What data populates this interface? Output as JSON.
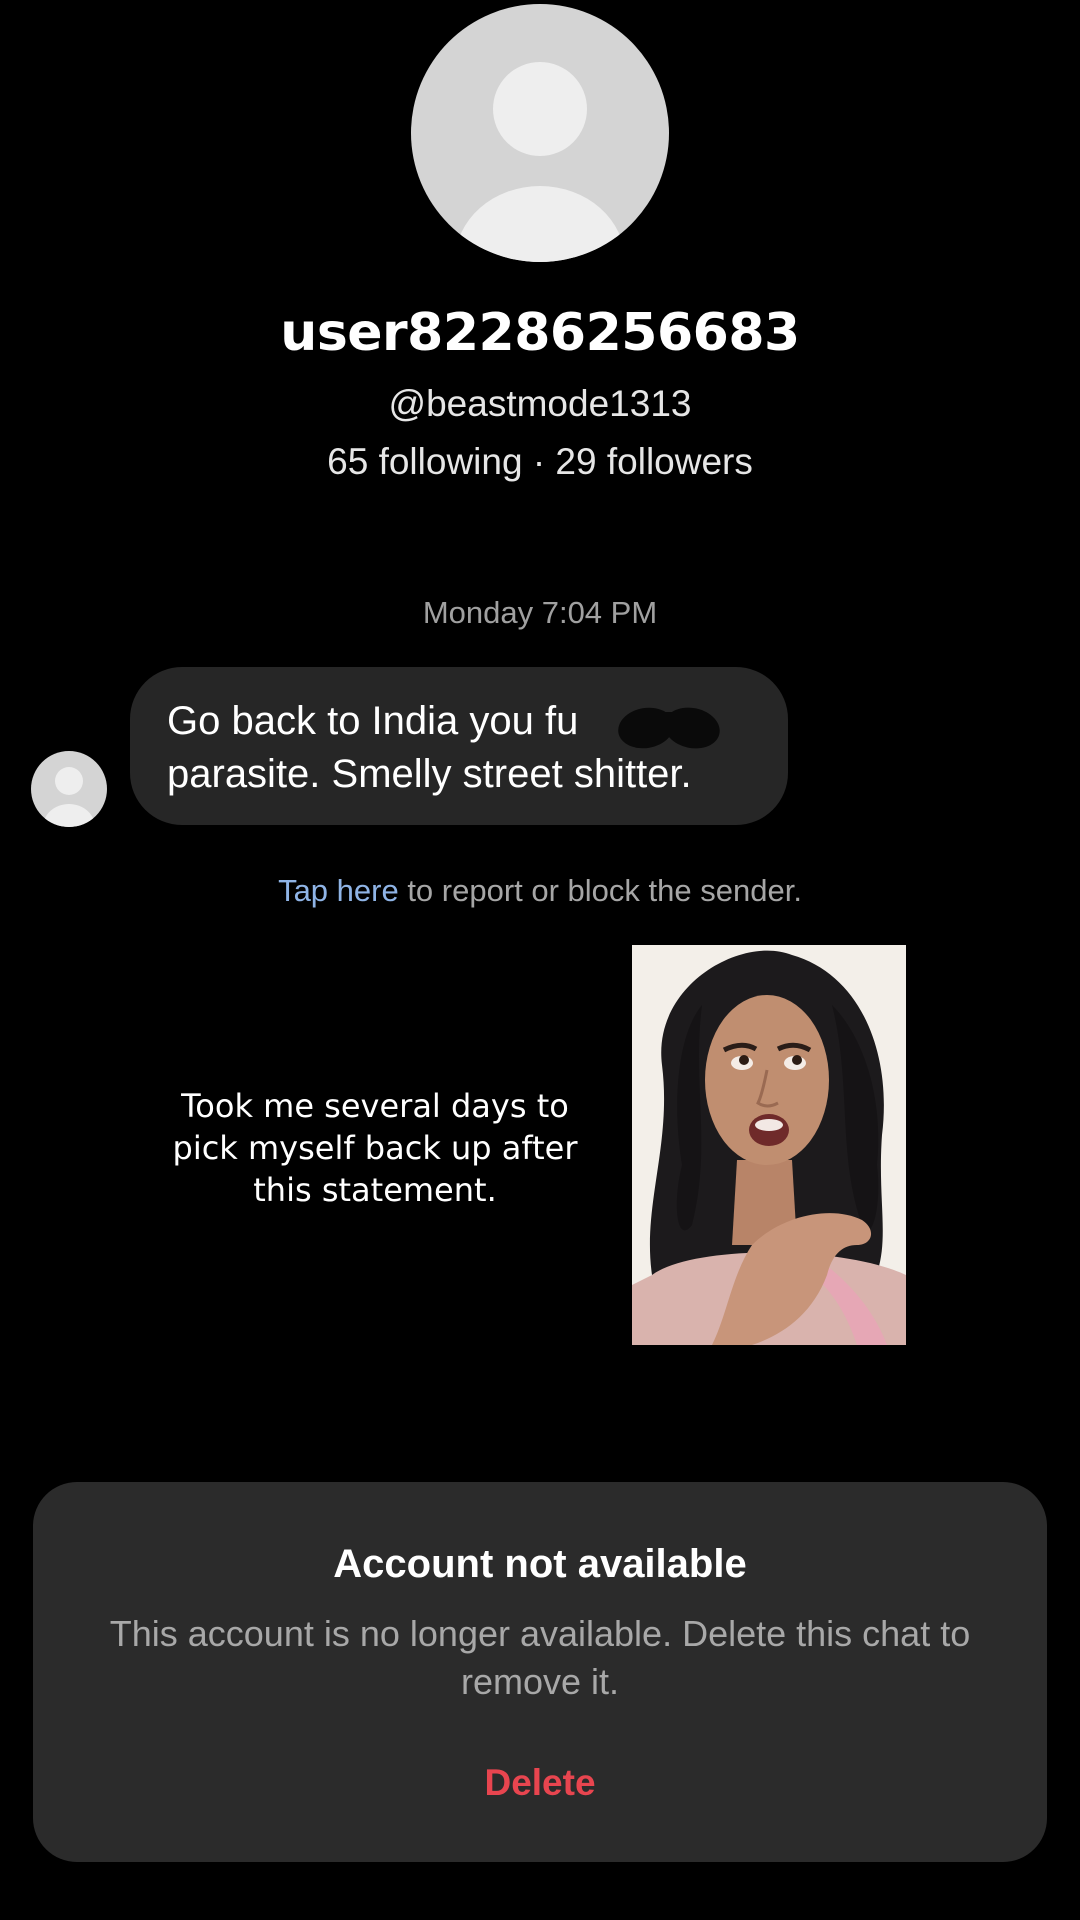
{
  "profile": {
    "display_name": "user82286256683",
    "handle": "@beastmode1313",
    "stats": "65 following · 29 followers",
    "avatar_icon": "default-avatar-icon"
  },
  "chat": {
    "timestamp": "Monday 7:04 PM",
    "message": {
      "line1": "Go back to India you fu      g",
      "line2": "parasite. Smelly street shitter."
    },
    "report": {
      "link_text": "Tap here",
      "rest_text": " to report or block the sender.",
      "link_color": "#8fb4e6"
    }
  },
  "overlay": {
    "caption": "Took me several days to pick myself back up after this statement."
  },
  "sheet": {
    "title": "Account not available",
    "body": "This account is no longer available. Delete this chat to remove it.",
    "delete_label": "Delete",
    "delete_color": "#e8454f"
  }
}
